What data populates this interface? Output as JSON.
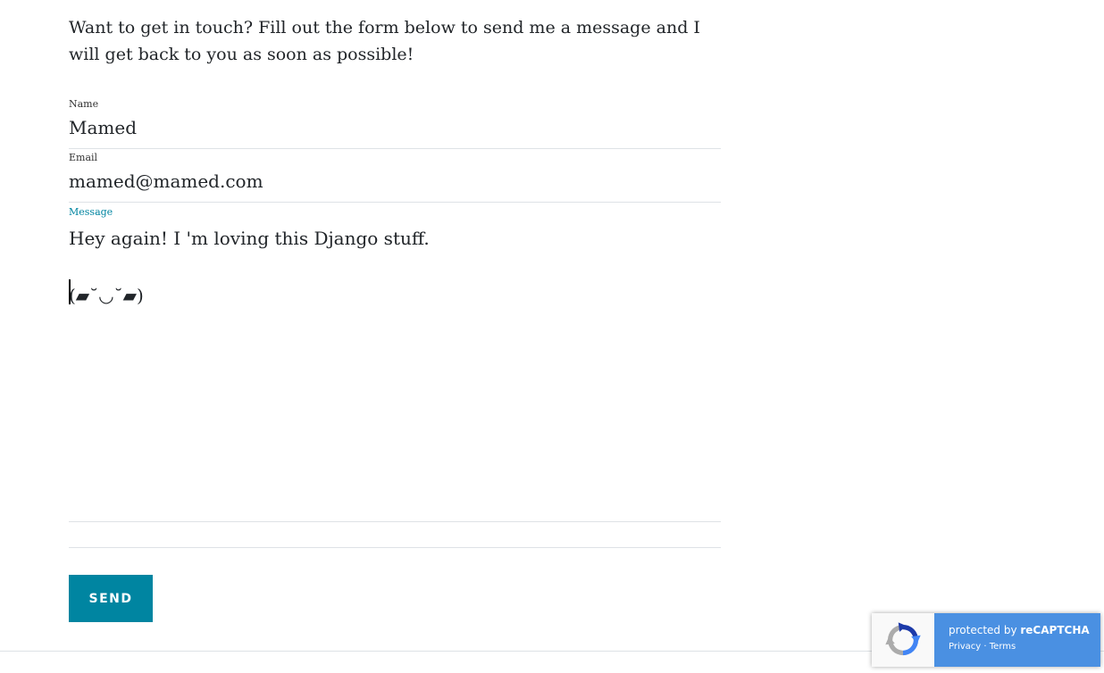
{
  "intro": {
    "text": "Want to get in touch? Fill out the form below to send me a message and I will get back to you as soon as possible!"
  },
  "form": {
    "name": {
      "label": "Name",
      "value": "Mamed"
    },
    "email": {
      "label": "Email",
      "value": "mamed@mamed.com"
    },
    "message": {
      "label": "Message",
      "value": "Hey again! I 'm loving this Django stuff.\n\n(▰˘◡˘▰)"
    },
    "send_label": "SEND"
  },
  "recaptcha": {
    "protected_prefix": "protected by ",
    "brand": "reCAPTCHA",
    "privacy": "Privacy",
    "separator": " · ",
    "terms": "Terms"
  },
  "colors": {
    "accent": "#0085a1",
    "recaptcha_blue": "#4a90e2"
  }
}
